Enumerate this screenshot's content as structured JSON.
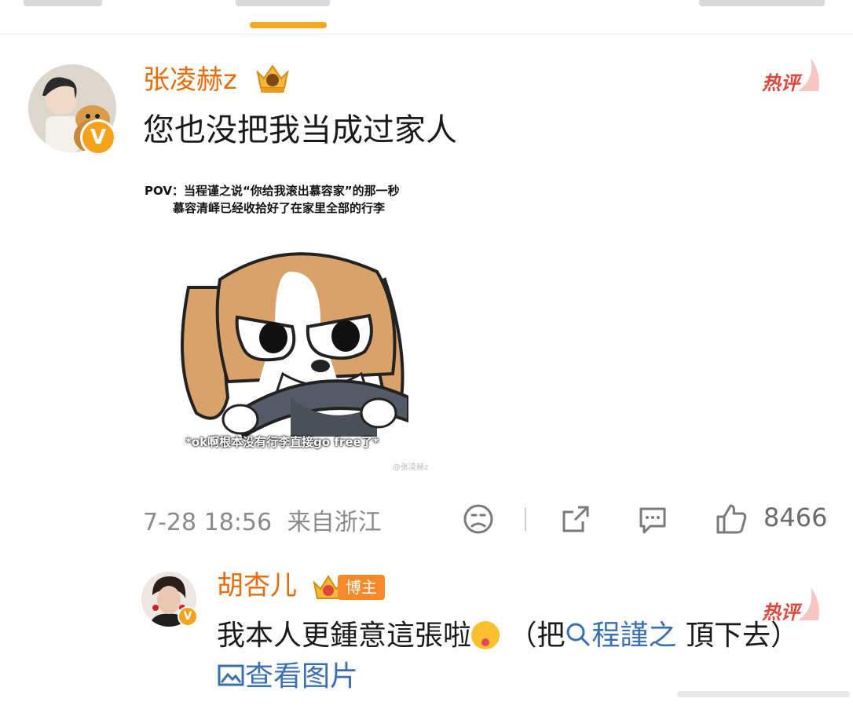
{
  "comment": {
    "username": "张凌赫z",
    "text": "您也没把我当成过家人",
    "hot_tag": "热评",
    "image": {
      "caption_line1": "POV：当程谨之说“你给我滚出慕容家”的那一秒",
      "caption_line2": "慕容清峄已经收拾好了在家里全部的行李",
      "subtitle": "*ok啊根本没有行李直接go free了*",
      "watermark": "@张凌赫z"
    },
    "meta": {
      "time": "7-28 18:56",
      "location": "来自浙江",
      "like_count": "8466"
    }
  },
  "reply": {
    "username": "胡杏儿",
    "badge": "博主",
    "hot_tag": "热评",
    "text_before": "我本人更鍾意這張啦",
    "text_paren_open": "（把",
    "link_text": "程謹之",
    "text_after": "頂下去）",
    "view_image": "查看图片"
  },
  "colors": {
    "accent": "#f5a623",
    "username": "#e86b0a",
    "hot": "#e0463a",
    "link": "#3a6fb3"
  },
  "icons": [
    "verified-icon",
    "crown-icon",
    "dislike-icon",
    "share-icon",
    "comment-icon",
    "like-icon",
    "search-icon",
    "image-icon"
  ]
}
